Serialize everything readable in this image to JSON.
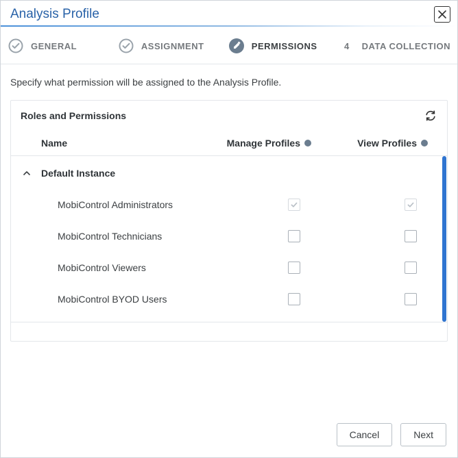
{
  "dialog": {
    "title": "Analysis Profile"
  },
  "stepper": {
    "steps": [
      {
        "label": "GENERAL",
        "done": true,
        "current": false
      },
      {
        "label": "ASSIGNMENT",
        "done": true,
        "current": false
      },
      {
        "label": "PERMISSIONS",
        "done": false,
        "current": true
      },
      {
        "label": "DATA COLLECTION",
        "done": false,
        "current": false,
        "num": "4"
      }
    ]
  },
  "body": {
    "instruction": "Specify what permission will be assigned to the Analysis Profile."
  },
  "panel": {
    "title": "Roles and Permissions",
    "columns": {
      "name": "Name",
      "manage": "Manage Profiles",
      "view": "View Profiles"
    },
    "group": {
      "name": "Default Instance",
      "expanded": true
    },
    "rows": [
      {
        "name": "MobiControl Administrators",
        "manage": true,
        "view": true,
        "disabled": true
      },
      {
        "name": "MobiControl Technicians",
        "manage": false,
        "view": false,
        "disabled": false
      },
      {
        "name": "MobiControl Viewers",
        "manage": false,
        "view": false,
        "disabled": false
      },
      {
        "name": "MobiControl BYOD Users",
        "manage": false,
        "view": false,
        "disabled": false
      }
    ]
  },
  "footer": {
    "cancel": "Cancel",
    "next": "Next"
  }
}
